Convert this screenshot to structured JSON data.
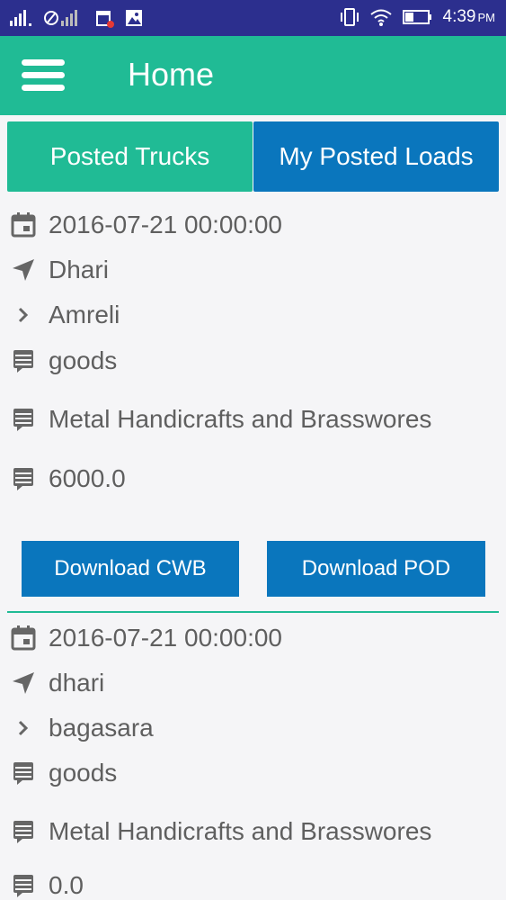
{
  "status_bar": {
    "time": "4:39",
    "ampm": "PM"
  },
  "header": {
    "title": "Home"
  },
  "tabs": [
    {
      "label": "Posted Trucks"
    },
    {
      "label": "My Posted Loads"
    }
  ],
  "loads": [
    {
      "date": "2016-07-21 00:00:00",
      "from": "Dhari",
      "to": "Amreli",
      "material": "goods",
      "company": "Metal Handicrafts and Brasswores",
      "amount": "6000.0",
      "download_cwb_label": "Download CWB",
      "download_pod_label": "Download POD"
    },
    {
      "date": "2016-07-21 00:00:00",
      "from": "dhari",
      "to": "bagasara",
      "material": "goods",
      "company": "Metal Handicrafts and Brasswores",
      "amount": "0.0"
    }
  ],
  "icons": {
    "date": "calendar-icon",
    "from": "navigation-arrow-icon",
    "to": "chevron-right-icon",
    "details": "notes-icon"
  },
  "colors": {
    "status_bar": "#2c2f8e",
    "primary": "#20bb95",
    "accent": "#0a76bd",
    "text": "#5f5f5f"
  }
}
